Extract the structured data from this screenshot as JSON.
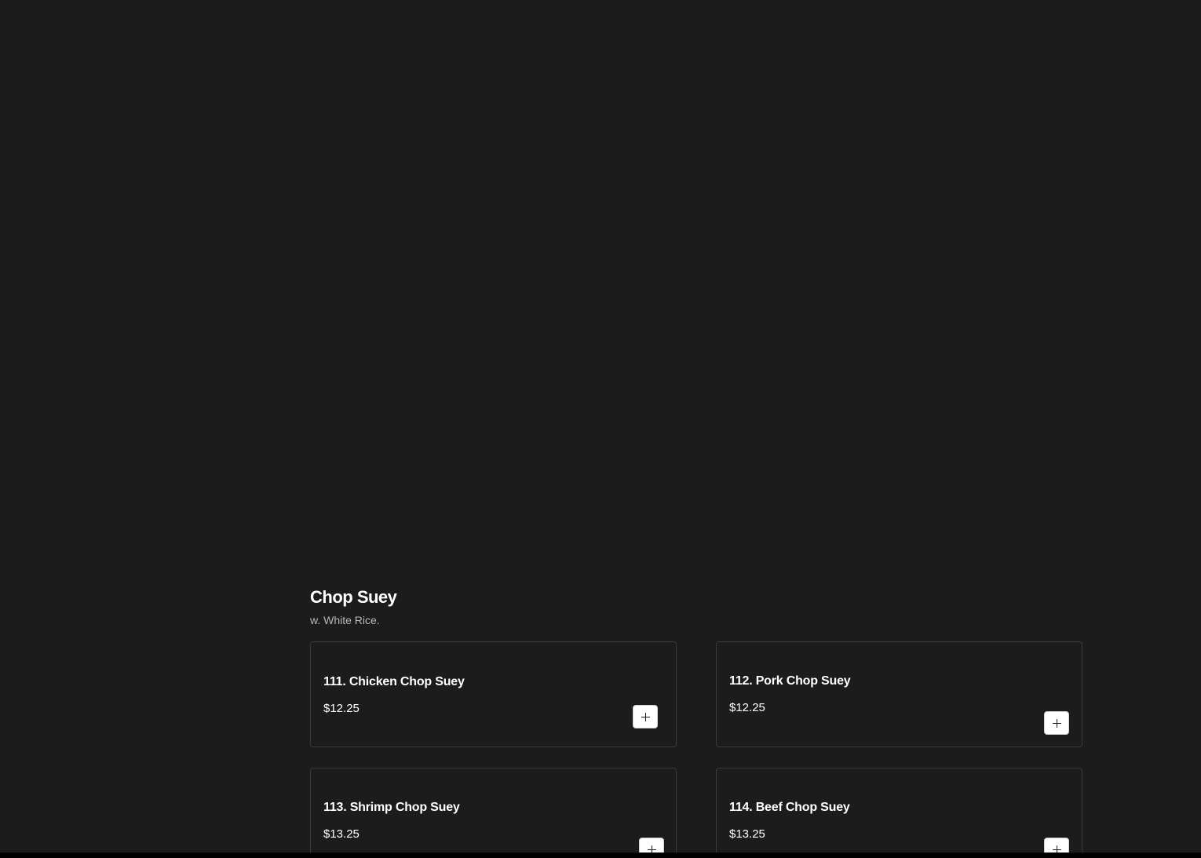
{
  "section": {
    "title": "Chop Suey",
    "subtitle": "w. White Rice."
  },
  "items": [
    {
      "name": "111. Chicken Chop Suey",
      "price": "$12.25",
      "add_label": "+"
    },
    {
      "name": "112. Pork Chop Suey",
      "price": "$12.25",
      "add_label": "+"
    },
    {
      "name": "113. Shrimp Chop Suey",
      "price": "$13.25",
      "add_label": "+"
    },
    {
      "name": "114. Beef Chop Suey",
      "price": "$13.25",
      "add_label": "+"
    }
  ],
  "colors": {
    "background": "#1c1c1c",
    "card_border": "#3a3a3a",
    "text": "#ffffff",
    "muted_text": "#b8b8b8",
    "button_bg": "#ffffff"
  },
  "icons": {
    "add": "plus-icon"
  }
}
